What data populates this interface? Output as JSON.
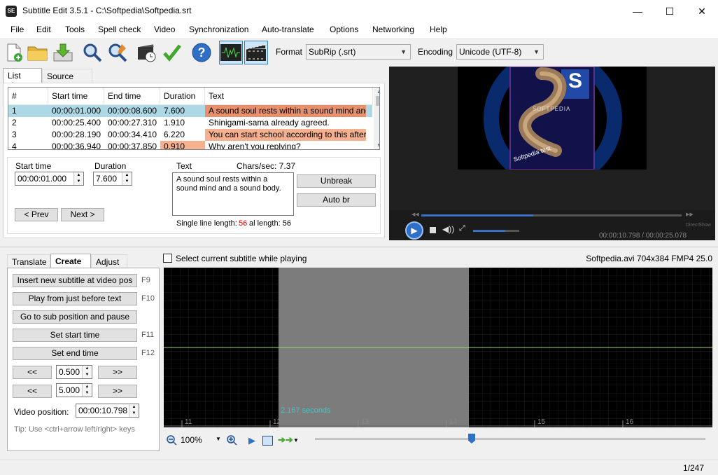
{
  "window": {
    "title": "Subtitle Edit 3.5.1 - C:\\Softpedia\\Softpedia.srt",
    "app_icon_text": "SE",
    "minimize": "—",
    "maximize": "☐",
    "close": "✕"
  },
  "menu": [
    "File",
    "Edit",
    "Tools",
    "Spell check",
    "Video",
    "Synchronization",
    "Auto-translate",
    "Options",
    "Networking",
    "Help"
  ],
  "toolbar": {
    "format_label": "Format",
    "format_value": "SubRip (.srt)",
    "encoding_label": "Encoding",
    "encoding_value": "Unicode (UTF-8)",
    "icons": [
      "new-file-icon",
      "open-folder-icon",
      "save-icon",
      "find-icon",
      "replace-icon",
      "visual-sync-icon",
      "spell-check-icon",
      "help-icon",
      "waveform-toggle-icon",
      "video-toggle-icon"
    ]
  },
  "view_tabs": [
    "List view",
    "Source view"
  ],
  "grid": {
    "headers": [
      "#",
      "Start time",
      "End time",
      "Duration",
      "Text"
    ],
    "rows": [
      {
        "num": "1",
        "start": "00:00:01.000",
        "end": "00:00:08.600",
        "duration": "7.600",
        "text": "A sound soul rests within a sound mind and a so"
      },
      {
        "num": "2",
        "start": "00:00:25.400",
        "end": "00:00:27.310",
        "duration": "1.910",
        "text": "Shinigami-sama already agreed."
      },
      {
        "num": "3",
        "start": "00:00:28.190",
        "end": "00:00:34.410",
        "duration": "6.220",
        "text": "You can start school according to this after..."
      },
      {
        "num": "4",
        "start": "00:00:36.940",
        "end": "00:00:37.850",
        "duration": "0.910",
        "text": "Why aren't you replying?"
      }
    ],
    "colors": {
      "selected": "#add8e6",
      "warn": "#f4a582"
    }
  },
  "editor": {
    "start_time_label": "Start time",
    "start_time_value": "00:00:01.000",
    "duration_label": "Duration",
    "duration_value": "7.600",
    "text_label": "Text",
    "chars_sec": "Chars/sec: 7.37",
    "text_value": "A sound soul rests within a sound mind and a sound body.",
    "unbreak": "Unbreak",
    "auto_br": "Auto br",
    "prev": "< Prev",
    "next": "Next >",
    "single_line_label": "Single line length:",
    "single_line_value": "56",
    "total_length_label": "al length: 56"
  },
  "video": {
    "logo_letter": "S",
    "caption": "Softpedia test",
    "brand": "SOFTPEDIA",
    "time_readout": "00:00:10.798 / 00:00:25.078",
    "renderer": "DirectShow"
  },
  "bottom_tabs": [
    "Translate",
    "Create",
    "Adjust"
  ],
  "create": {
    "insert_label": "Insert new subtitle at video pos",
    "insert_key": "F9",
    "play_before_label": "Play from just before text",
    "play_before_key": "F10",
    "goto_pause_label": "Go to sub position and pause",
    "set_start_label": "Set start time",
    "set_start_key": "F11",
    "set_end_label": "Set end time",
    "set_end_key": "F12",
    "back": "<<",
    "forward": ">>",
    "step1": "0.500",
    "step2": "5.000",
    "video_pos_label": "Video position:",
    "video_pos_value": "00:00:10.798",
    "tip": "Tip: Use <ctrl+arrow left/right> keys"
  },
  "waveform": {
    "select_while_playing": "Select current subtitle while playing",
    "file_info": "Softpedia.avi 704x384 FMP4 25.0",
    "duration_text": "2.167 seconds",
    "ticks": [
      "11",
      "12",
      "13",
      "14",
      "15",
      "16"
    ],
    "zoom": "100%"
  },
  "status": {
    "count": "1/247"
  }
}
